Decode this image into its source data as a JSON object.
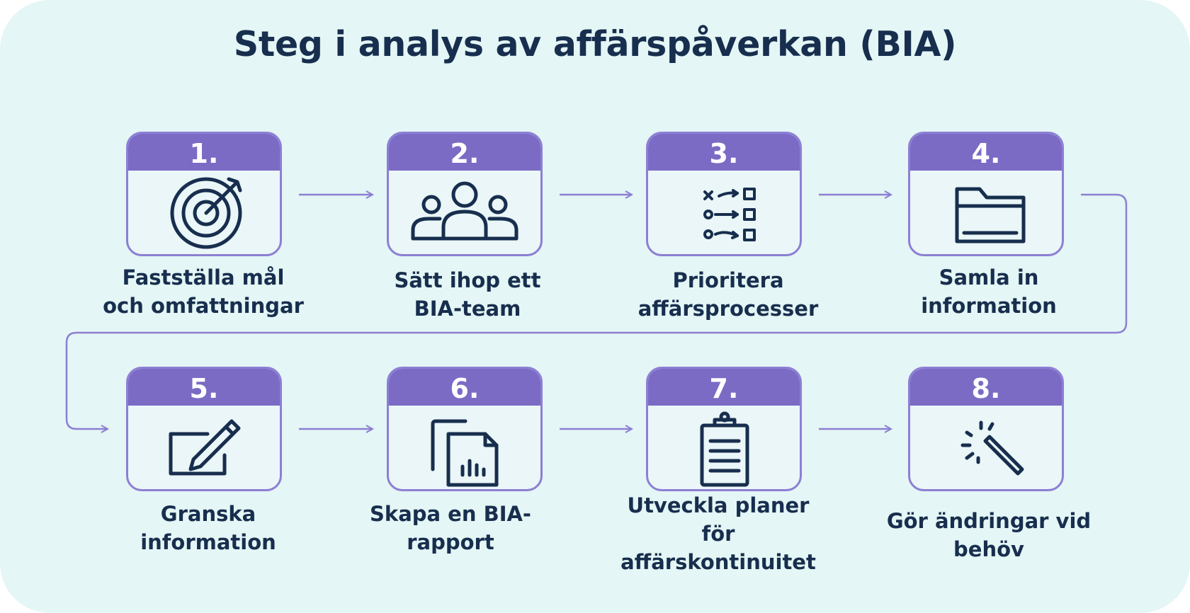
{
  "title": "Steg i analys av affärspåverkan (BIA)",
  "colors": {
    "background": "#e4f6f5",
    "card_header": "#7b6bc5",
    "card_border": "#8c7fd4",
    "arrow": "#8c7fd4",
    "text": "#172e4e"
  },
  "steps": [
    {
      "number": "1.",
      "label_line1": "Fastställa mål",
      "label_line2": "och omfattningar",
      "icon": "target-icon"
    },
    {
      "number": "2.",
      "label_line1": "Sätt ihop ett",
      "label_line2": "BIA-team",
      "icon": "team-icon"
    },
    {
      "number": "3.",
      "label_line1": "Prioritera",
      "label_line2": "affärsprocesser",
      "icon": "priority-list-icon"
    },
    {
      "number": "4.",
      "label_line1": "Samla in",
      "label_line2": "information",
      "icon": "folder-icon"
    },
    {
      "number": "5.",
      "label_line1": "Granska",
      "label_line2": "information",
      "icon": "edit-icon"
    },
    {
      "number": "6.",
      "label_line1": "Skapa en BIA-",
      "label_line2": "rapport",
      "icon": "report-icon"
    },
    {
      "number": "7.",
      "label_line1": "Utveckla planer",
      "label_line2": "för",
      "label_line3": "affärskontinuitet",
      "icon": "clipboard-icon"
    },
    {
      "number": "8.",
      "label_line1": "Gör ändringar vid",
      "label_line2": "behöv",
      "icon": "magic-wand-icon"
    }
  ]
}
